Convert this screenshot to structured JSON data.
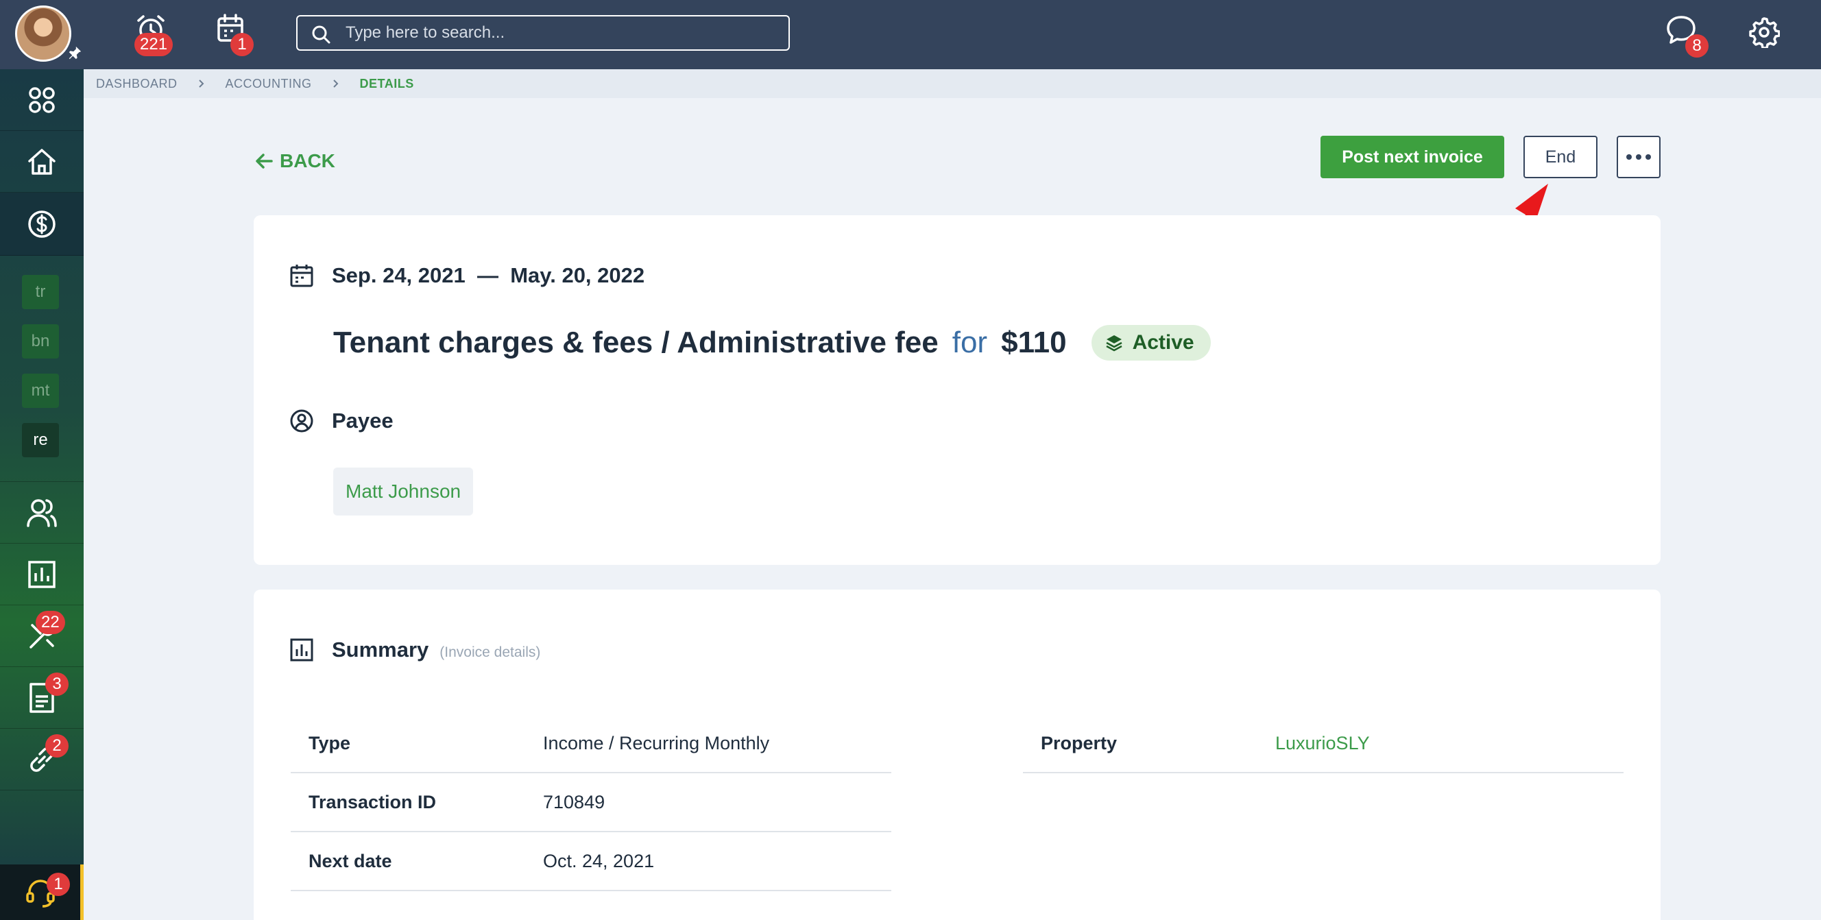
{
  "topbar": {
    "alarm_badge": "221",
    "calendar_badge": "1",
    "chat_badge": "8",
    "search_placeholder": "Type here to search..."
  },
  "sidebar": {
    "short_items": [
      "tr",
      "bn",
      "mt",
      "re"
    ],
    "tools_badge": "22",
    "docs_badge": "3",
    "links_badge": "2",
    "support_badge": "1"
  },
  "breadcrumb": [
    "DASHBOARD",
    "ACCOUNTING",
    "DETAILS"
  ],
  "actions": {
    "back": "BACK",
    "post_next_invoice": "Post next invoice",
    "end": "End"
  },
  "transaction": {
    "start_date": "Sep. 24, 2021",
    "separator": "—",
    "end_date": "May. 20, 2022",
    "title": "Tenant charges & fees / Administrative fee",
    "for_word": "for",
    "amount": "$110",
    "status": "Active",
    "payee_label": "Payee",
    "payee_name": "Matt Johnson"
  },
  "summary": {
    "title": "Summary",
    "subtitle": "(Invoice details)",
    "left_rows": [
      {
        "key": "Type",
        "value": "Income / Recurring Monthly"
      },
      {
        "key": "Transaction ID",
        "value": "710849"
      },
      {
        "key": "Next date",
        "value": "Oct. 24, 2021"
      }
    ],
    "right_rows": [
      {
        "key": "Property",
        "value": "LuxurioSLY"
      }
    ]
  },
  "colors": {
    "topbar": "#34445c",
    "accent_green": "#3da03f",
    "badge_red": "#e03b3b",
    "annotation_red": "#e8191c"
  }
}
